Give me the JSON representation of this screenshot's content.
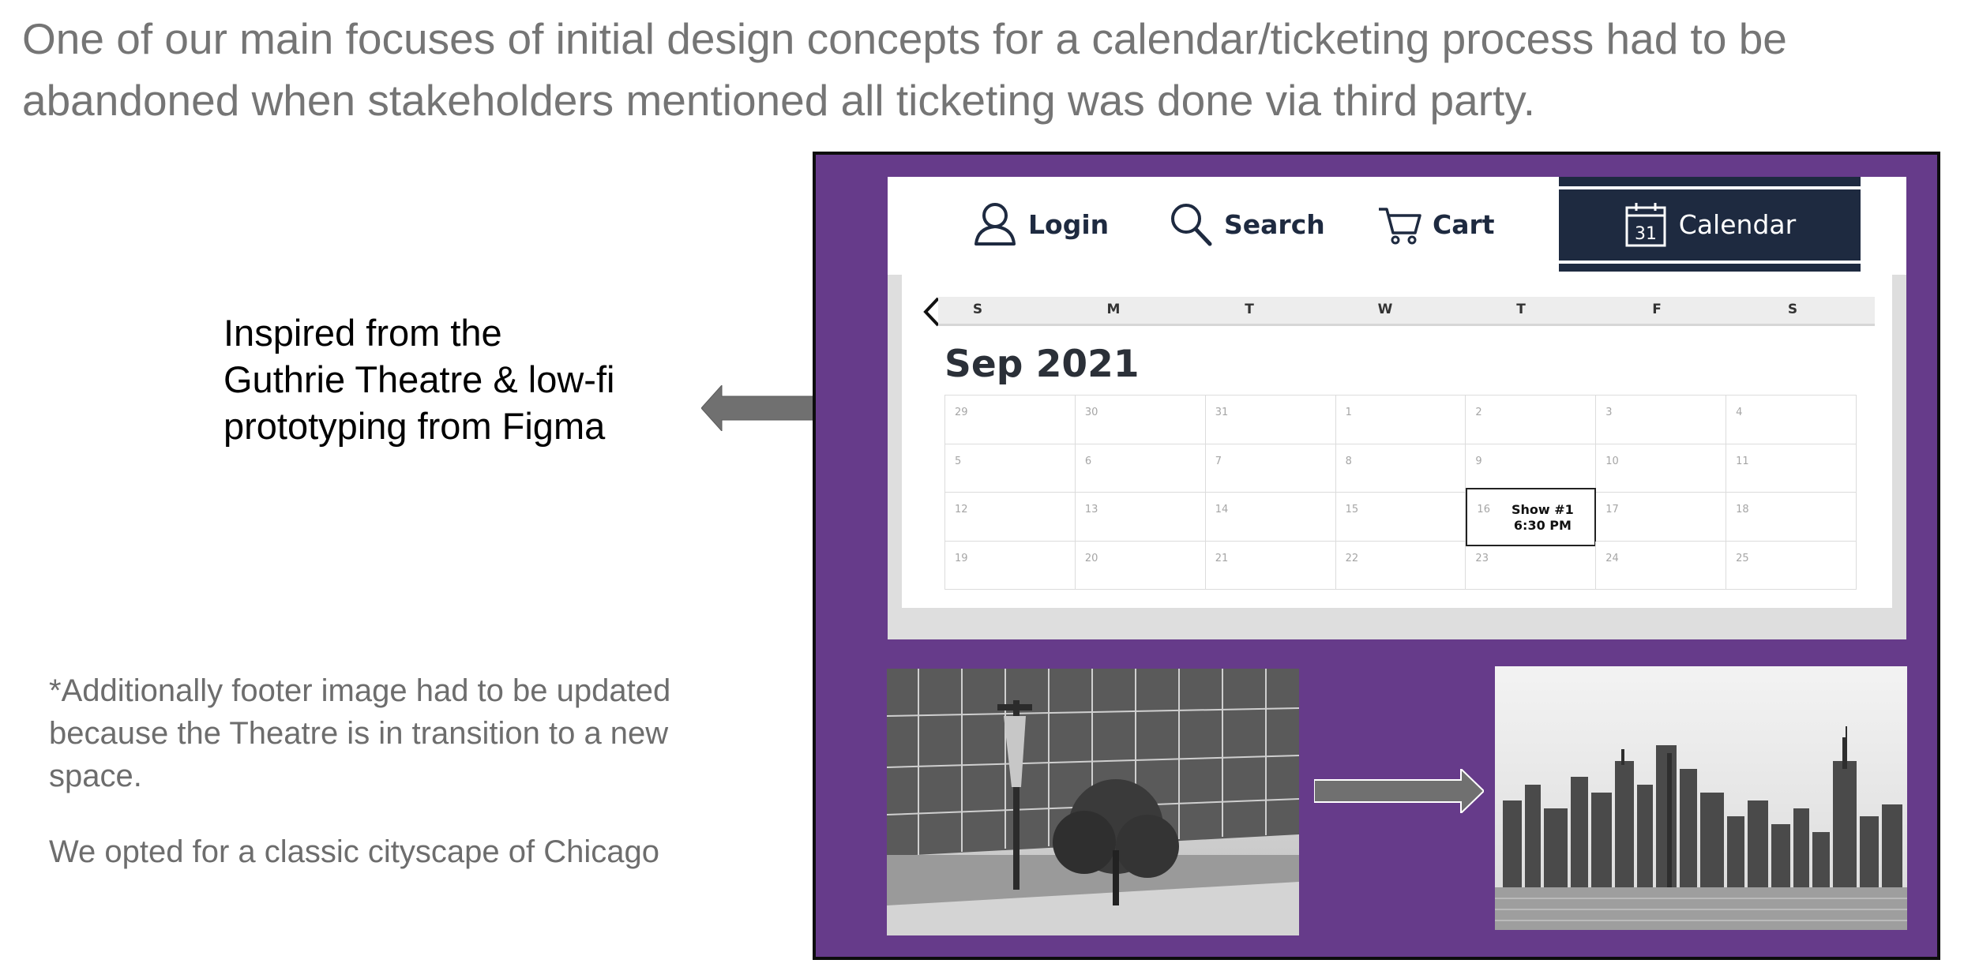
{
  "intro_text": "One of our main focuses of initial design concepts for a calendar/ticketing process had to be abandoned when stakeholders mentioned all ticketing was done via third party.",
  "inspiration": {
    "line1": "Inspired from the",
    "line2": "Guthrie Theatre & low-fi",
    "line3": "prototyping from Figma"
  },
  "footnote": {
    "paragraph1": "*Additionally footer image had to be updated because the Theatre is in transition to a new space.",
    "paragraph2": "We opted for a classic cityscape of Chicago"
  },
  "colors": {
    "frame_purple": "#663b8a",
    "navy": "#1e2a40",
    "arrow_gray": "#707070"
  },
  "mockup": {
    "nav": {
      "login": "Login",
      "search": "Search",
      "cart": "Cart",
      "calendar": "Calendar",
      "calendar_icon_day": "31"
    },
    "calendar": {
      "month_title": "Sep 2021",
      "weekdays": [
        "S",
        "M",
        "T",
        "W",
        "T",
        "F",
        "S"
      ],
      "weeks": [
        [
          "29",
          "30",
          "31",
          "1",
          "2",
          "3",
          "4"
        ],
        [
          "5",
          "6",
          "7",
          "8",
          "9",
          "10",
          "11"
        ],
        [
          "12",
          "13",
          "14",
          "15",
          "16",
          "17",
          "18"
        ],
        [
          "19",
          "20",
          "21",
          "22",
          "23",
          "24",
          "25"
        ]
      ],
      "event": {
        "day": "16",
        "title": "Show #1",
        "time": "6:30 PM"
      }
    }
  },
  "images": {
    "before": "grayscale photo of theatre building with glass facade, lamp post with banner, tree",
    "after": "grayscale photo of Chicago skyline across water"
  }
}
